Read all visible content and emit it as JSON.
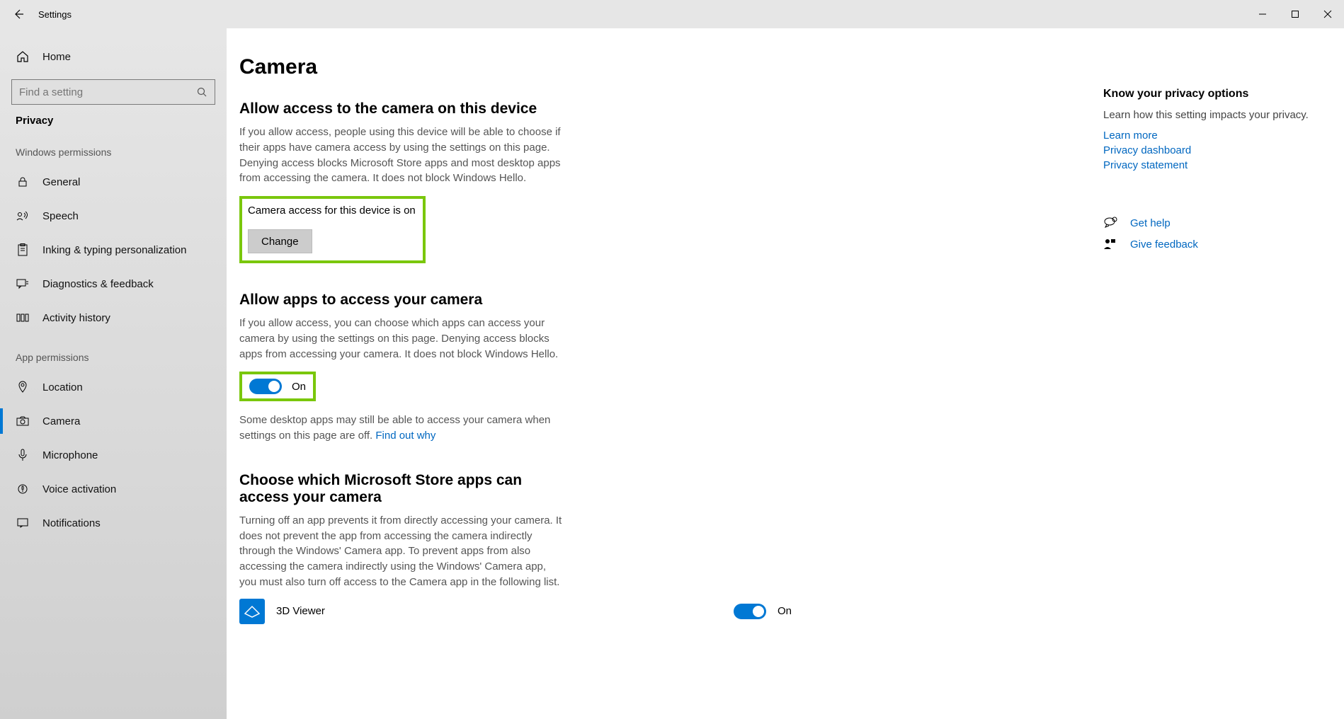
{
  "titlebar": {
    "title": "Settings"
  },
  "sidebar": {
    "home": "Home",
    "search_placeholder": "Find a setting",
    "current": "Privacy",
    "group_windows": "Windows permissions",
    "group_app": "App permissions",
    "items_win": [
      {
        "label": "General"
      },
      {
        "label": "Speech"
      },
      {
        "label": "Inking & typing personalization"
      },
      {
        "label": "Diagnostics & feedback"
      },
      {
        "label": "Activity history"
      }
    ],
    "items_app": [
      {
        "label": "Location"
      },
      {
        "label": "Camera"
      },
      {
        "label": "Microphone"
      },
      {
        "label": "Voice activation"
      },
      {
        "label": "Notifications"
      }
    ]
  },
  "page": {
    "title": "Camera",
    "sec1_title": "Allow access to the camera on this device",
    "sec1_desc": "If you allow access, people using this device will be able to choose if their apps have camera access by using the settings on this page. Denying access blocks Microsoft Store apps and most desktop apps from accessing the camera. It does not block Windows Hello.",
    "sec1_status": "Camera access for this device is on",
    "change_btn": "Change",
    "sec2_title": "Allow apps to access your camera",
    "sec2_desc": "If you allow access, you can choose which apps can access your camera by using the settings on this page. Denying access blocks apps from accessing your camera. It does not block Windows Hello.",
    "toggle_on": "On",
    "sec2_note_a": "Some desktop apps may still be able to access your camera when settings on this page are off. ",
    "sec2_note_link": "Find out why",
    "sec3_title": "Choose which Microsoft Store apps can access your camera",
    "sec3_desc": "Turning off an app prevents it from directly accessing your camera. It does not prevent the app from accessing the camera indirectly through the Windows' Camera app. To prevent apps from also accessing the camera indirectly using the Windows' Camera app, you must also turn off access to the Camera app in the following list.",
    "app1": {
      "name": "3D Viewer",
      "state": "On"
    }
  },
  "right": {
    "title": "Know your privacy options",
    "desc": "Learn how this setting impacts your privacy.",
    "links": [
      "Learn more",
      "Privacy dashboard",
      "Privacy statement"
    ],
    "help": "Get help",
    "feedback": "Give feedback"
  }
}
